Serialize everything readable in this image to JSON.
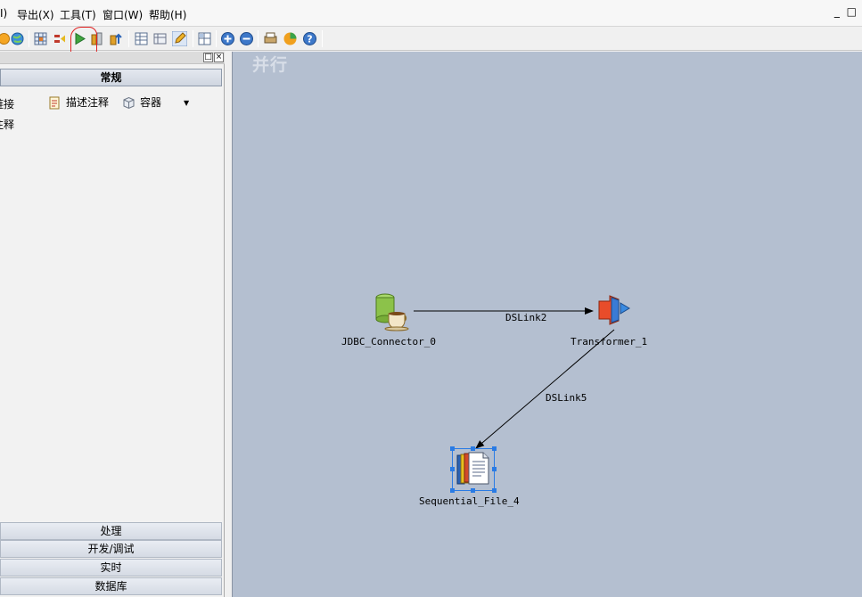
{
  "menu": {
    "items": [
      "I)",
      "导出(X)",
      "工具(T)",
      "窗口(W)",
      "帮助(H)"
    ],
    "window_controls": "_ □"
  },
  "toolbar": {
    "buttons": [
      "open-icon",
      "globe-icon",
      "grid-icon",
      "compile-icon",
      "run-icon",
      "schedule-icon",
      "import-icon",
      "table-icon",
      "columns-icon",
      "edit-icon",
      "layout-icon",
      "zoom-in-icon",
      "zoom-out-icon",
      "print-icon",
      "pie-icon",
      "help-icon"
    ]
  },
  "palette": {
    "header": "常规",
    "tools": {
      "link": "链接",
      "annotation": "描述注释",
      "container": "容器",
      "annotation2": "注释"
    },
    "sections": [
      "处理",
      "开发/调试",
      "实时",
      "数据库"
    ]
  },
  "canvas": {
    "title": "并行",
    "stages": {
      "jdbc": "JDBC_Connector_0",
      "transformer": "Transformer_1",
      "seqfile": "Sequential_File_4"
    },
    "links": {
      "link2": "DSLink2",
      "link5": "DSLink5"
    }
  },
  "colors": {
    "canvas_bg": "#b4bfd0",
    "selection": "#2a7be4",
    "annotation_red": "#e02020"
  }
}
